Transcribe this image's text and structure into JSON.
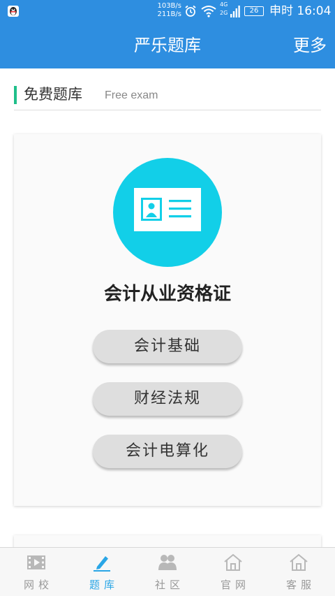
{
  "status": {
    "speed_up": "103B/s",
    "speed_down": "211B/s",
    "net_4g": "4G",
    "net_2g": "2G",
    "battery": "26",
    "time": "申时 16:04"
  },
  "header": {
    "title": "严乐题库",
    "more": "更多"
  },
  "section": {
    "title": "免费题库",
    "subtitle": "Free exam"
  },
  "card": {
    "icon": "id-card-icon",
    "title": "会计从业资格证",
    "buttons": [
      "会计基础",
      "财经法规",
      "会计电算化"
    ]
  },
  "tabs": [
    {
      "label": "网校",
      "icon": "film-icon",
      "active": false
    },
    {
      "label": "题库",
      "icon": "pen-icon",
      "active": true
    },
    {
      "label": "社区",
      "icon": "people-icon",
      "active": false
    },
    {
      "label": "官网",
      "icon": "home-icon",
      "active": false
    },
    {
      "label": "客服",
      "icon": "home-icon",
      "active": false
    }
  ],
  "colors": {
    "primary": "#2e8ee0",
    "accent_green": "#1fbf8a",
    "icon_cyan": "#12cfe8",
    "tab_active": "#2aa6e6"
  }
}
